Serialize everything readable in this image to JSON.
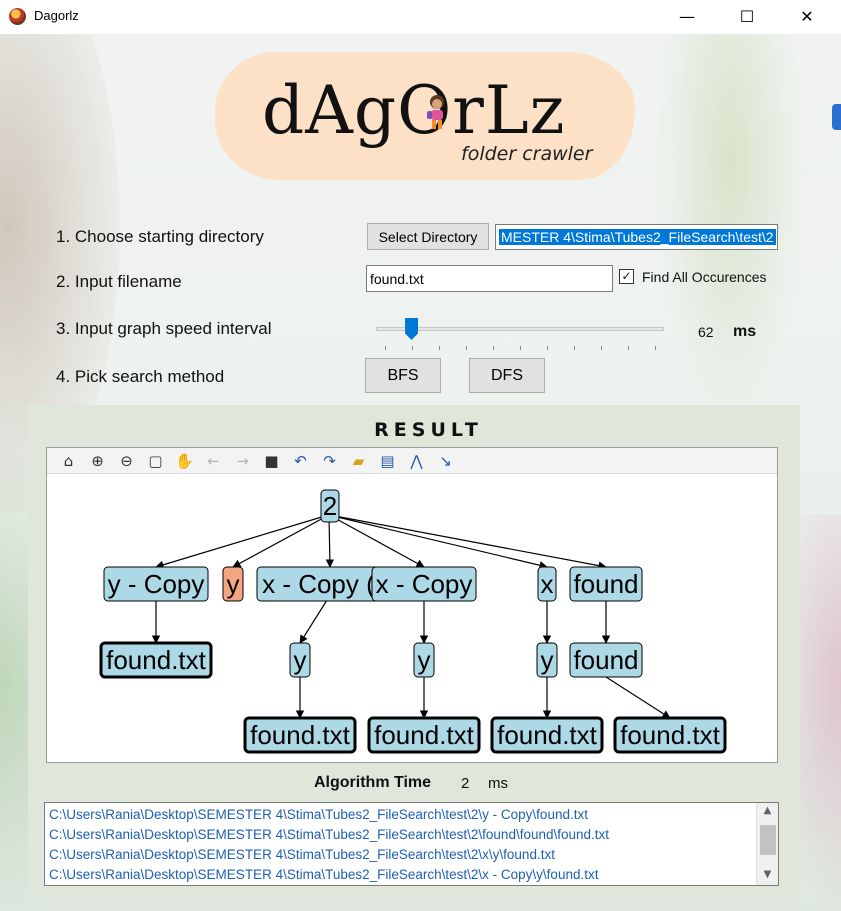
{
  "window": {
    "title": "Dagorlz",
    "minimize": "—",
    "maximize": "☐",
    "close": "✕"
  },
  "logo": {
    "title": "dAgOrLz",
    "subtitle": "folder crawler"
  },
  "steps": {
    "directory": {
      "label": "1. Choose starting directory",
      "button": "Select Directory",
      "value": "MESTER 4\\Stima\\Tubes2_FileSearch\\test\\2"
    },
    "filename": {
      "label": "2. Input filename",
      "value": "found.txt",
      "checkbox_label": "Find All Occurences",
      "checked": true
    },
    "speed": {
      "label": "3. Input graph speed interval",
      "value": "62",
      "unit": "ms",
      "level_percent": 8
    },
    "method": {
      "label": "4. Pick search method",
      "bfs": "BFS",
      "dfs": "DFS"
    }
  },
  "result": {
    "title": "RESULT",
    "toolbar": [
      "home-icon",
      "zoom-in-icon",
      "zoom-out-icon",
      "select-rect-icon",
      "pan-hand-icon",
      "back-arrow-icon",
      "forward-arrow-icon",
      "save-icon",
      "undo-icon",
      "redo-icon",
      "open-folder-icon",
      "print-icon",
      "layout-icon",
      "arrow-tool-icon"
    ],
    "graph": {
      "root": "2",
      "level1": [
        "y - Copy",
        "y",
        "x - Copy (2)",
        "x - Copy",
        "x",
        "found"
      ],
      "level2": [
        "found.txt",
        "y",
        "y",
        "y",
        "found"
      ],
      "level3": [
        "found.txt",
        "found.txt",
        "found.txt",
        "found.txt"
      ],
      "colors": {
        "node": "#add8e6",
        "highlight": "#f4a582",
        "edge": "#000000"
      }
    },
    "algorithm_time": {
      "label": "Algorithm Time",
      "value": "2",
      "unit": "ms"
    },
    "paths": [
      "C:\\Users\\Rania\\Desktop\\SEMESTER 4\\Stima\\Tubes2_FileSearch\\test\\2\\y - Copy\\found.txt",
      "C:\\Users\\Rania\\Desktop\\SEMESTER 4\\Stima\\Tubes2_FileSearch\\test\\2\\found\\found\\found.txt",
      "C:\\Users\\Rania\\Desktop\\SEMESTER 4\\Stima\\Tubes2_FileSearch\\test\\2\\x\\y\\found.txt",
      "C:\\Users\\Rania\\Desktop\\SEMESTER 4\\Stima\\Tubes2_FileSearch\\test\\2\\x - Copy\\y\\found.txt"
    ]
  }
}
